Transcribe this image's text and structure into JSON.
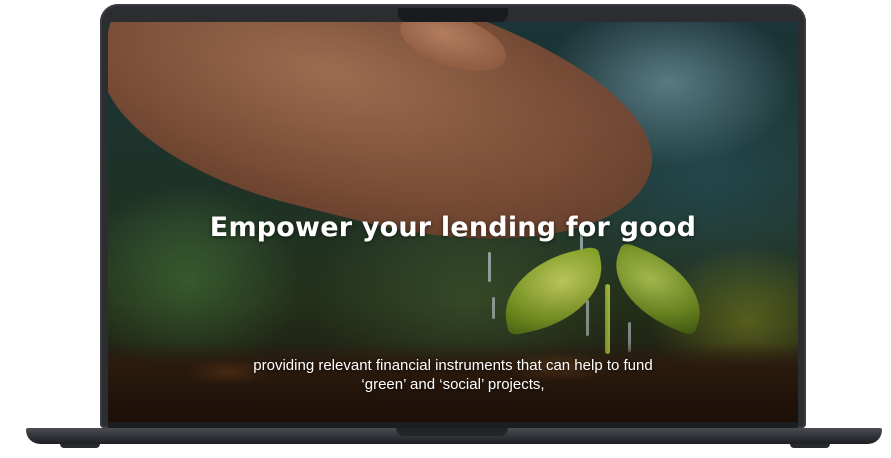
{
  "hero": {
    "headline": "Empower your lending for good",
    "subtext_line1": "providing relevant financial instruments that can help to fund",
    "subtext_line2": "‘green’ and ‘social’ projects,"
  },
  "colors": {
    "device_body": "#2b2d31",
    "text": "#ffffff",
    "leaf": "#9db82b",
    "soil": "#3a2413"
  }
}
